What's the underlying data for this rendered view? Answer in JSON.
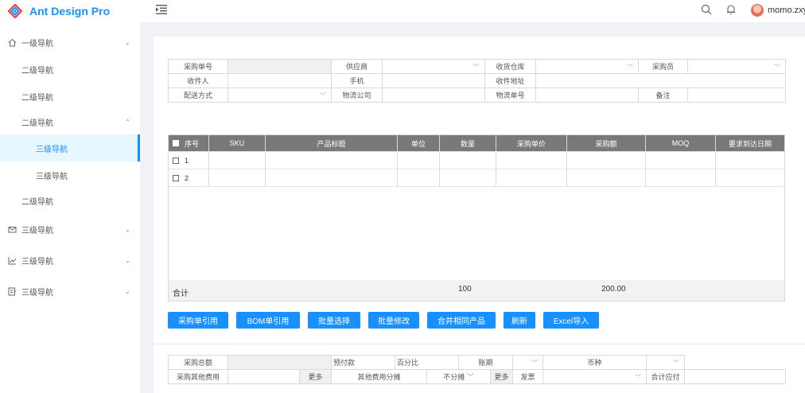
{
  "brand": {
    "title": "Ant Design Pro",
    "primary_color": "#1890ff"
  },
  "header": {
    "user_name": "momo.zxy",
    "icons": [
      "search-icon",
      "bell-icon"
    ]
  },
  "sidebar": {
    "items": [
      {
        "label": "一级导航",
        "icon": "home-icon",
        "arrow": "⌄"
      },
      {
        "label": "二级导航"
      },
      {
        "label": "二级导航"
      },
      {
        "label": "二级导航",
        "arrow": "⌃"
      },
      {
        "label": "三级导航",
        "active": true
      },
      {
        "label": "三级导航"
      },
      {
        "label": "二级导航"
      },
      {
        "label": "三级导航",
        "icon": "mail-icon",
        "arrow": "⌄"
      },
      {
        "label": "三级导航",
        "icon": "chart-icon",
        "arrow": "⌄"
      },
      {
        "label": "三级导航",
        "icon": "form-icon",
        "arrow": "⌄"
      }
    ]
  },
  "order_form": {
    "purchase_no": "采购单号",
    "supplier": "供应商",
    "warehouse": "收货仓库",
    "buyer": "采购员",
    "receiver": "收件人",
    "phone": "手机",
    "address": "收件地址",
    "shipping": "配送方式",
    "logistics_company": "物流公司",
    "tracking_no": "物流单号",
    "note": "备注"
  },
  "grid": {
    "columns": [
      "序号",
      "SKU",
      "产品标题",
      "单位",
      "数量",
      "采购单价",
      "采购额",
      "MOQ",
      "要求到达日期"
    ],
    "rows": [
      {
        "no": "1"
      },
      {
        "no": "2"
      }
    ],
    "footer": {
      "label": "合计",
      "qty_total": "100",
      "amount_total": "200.00"
    }
  },
  "actions": [
    "采购单引用",
    "BOM单引用",
    "批量选择",
    "批量修改",
    "合并相同产品",
    "刷新",
    "Excel导入"
  ],
  "summary_form": {
    "total_label": "采购总额",
    "prepay_label": "预付款",
    "percent_label": "百分比",
    "period_label": "账期",
    "currency_label": "币种",
    "other_fee_label": "采购其他费用",
    "more_label": "更多",
    "allocation_label": "其他费用分摊",
    "allocation_value": "不分摊",
    "more2_label": "更多",
    "invoice_label": "发票",
    "payable_label": "合计应付"
  }
}
